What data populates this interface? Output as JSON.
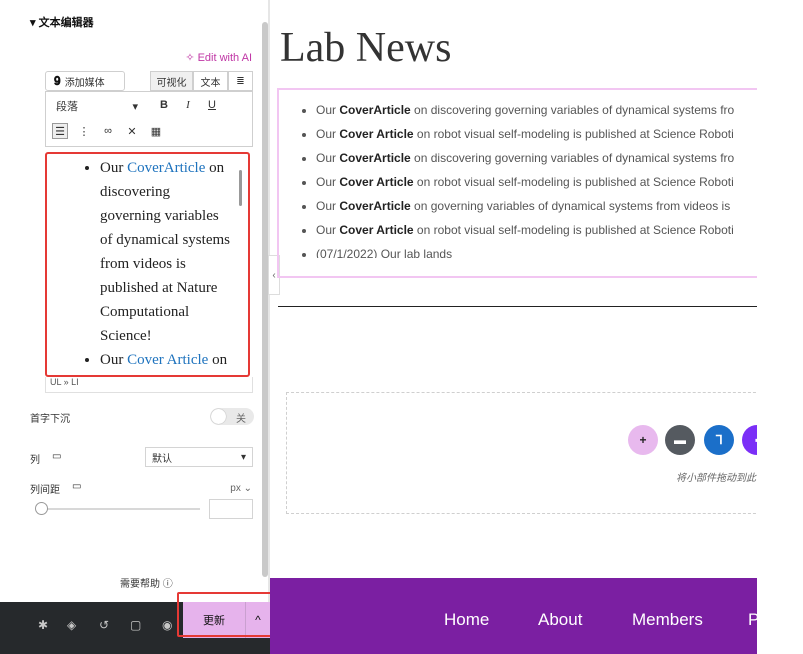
{
  "editor": {
    "section_title": "▾ 文本编辑器",
    "edit_ai": "✧ Edit with AI",
    "add_media": "添加媒体",
    "tab_visual": "可视化",
    "tab_text": "文本",
    "format_select": "段落",
    "bold": "B",
    "italic": "I",
    "underline": "U",
    "content_items": [
      {
        "before": "Our ",
        "link": "CoverArticle",
        "after": " on discovering governing variables of dynamical systems from videos is published at Nature Computational Science!"
      },
      {
        "before": "Our ",
        "link": "Cover Article",
        "after": " on"
      }
    ],
    "path": "UL » LI"
  },
  "controls": {
    "drop_cap_label": "首字下沉",
    "drop_cap_value": "关",
    "columns_label": "列",
    "columns_value": "默认",
    "column_gap_label": "列间距",
    "column_gap_unit": "px ⌄",
    "help": "需要帮助 ⓘ"
  },
  "bottombar": {
    "update": "更新",
    "caret": "^"
  },
  "canvas": {
    "title": "Lab News",
    "news": [
      {
        "pre": "Our ",
        "bold": "CoverArticle",
        "post": " on discovering governing variables of dynamical systems fro"
      },
      {
        "pre": "Our ",
        "bold": "Cover Article",
        "post": " on robot visual self-modeling is published at Science Roboti"
      },
      {
        "pre": "Our ",
        "bold": "CoverArticle",
        "post": " on discovering governing variables of dynamical systems fro"
      },
      {
        "pre": "Our ",
        "bold": "Cover Article",
        "post": " on robot visual self-modeling is published at Science Roboti"
      },
      {
        "pre": "Our ",
        "bold": "CoverArticle",
        "post": " on  governing variables of dynamical systems from videos is"
      },
      {
        "pre": "Our ",
        "bold": "Cover Article",
        "post": " on robot visual self-modeling is published at Science Roboti"
      },
      {
        "pre": "(07/1/2022) Our lab lands",
        "bold": "",
        "post": ""
      }
    ],
    "drop_text": "将小部件拖动到此",
    "nav": [
      "Home",
      "About",
      "Members",
      "P"
    ]
  },
  "colors": {
    "footer": "#7b1fa2",
    "update_button": "#e6b3ec",
    "highlight": "#e53935",
    "link": "#1e73be"
  }
}
